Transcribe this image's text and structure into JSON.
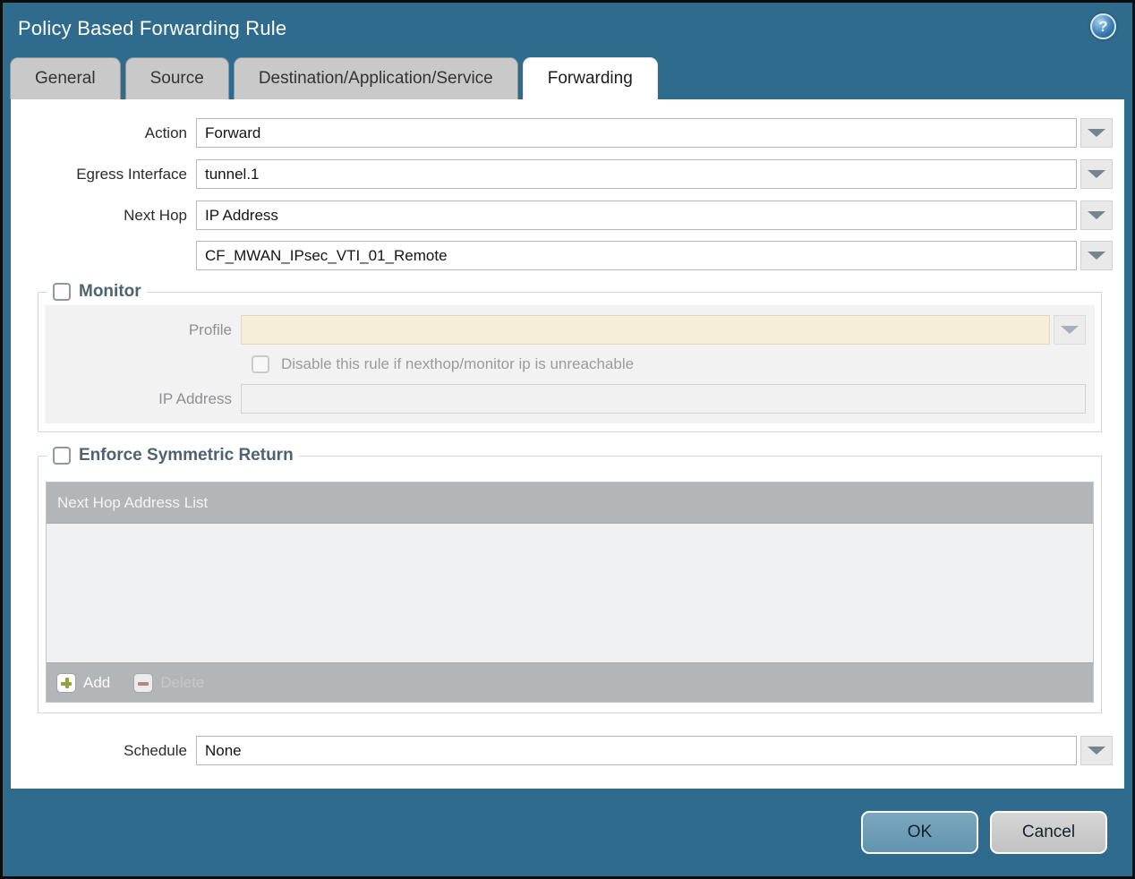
{
  "dialog": {
    "title": "Policy Based Forwarding Rule",
    "help_glyph": "?"
  },
  "tabs": [
    {
      "label": "General",
      "active": false
    },
    {
      "label": "Source",
      "active": false
    },
    {
      "label": "Destination/Application/Service",
      "active": false
    },
    {
      "label": "Forwarding",
      "active": true
    }
  ],
  "form": {
    "action": {
      "label": "Action",
      "value": "Forward"
    },
    "egress_interface": {
      "label": "Egress Interface",
      "value": "tunnel.1"
    },
    "next_hop": {
      "label": "Next Hop",
      "type_value": "IP Address",
      "address_value": "CF_MWAN_IPsec_VTI_01_Remote"
    },
    "schedule": {
      "label": "Schedule",
      "value": "None"
    }
  },
  "monitor": {
    "legend": "Monitor",
    "checked": false,
    "profile": {
      "label": "Profile",
      "value": ""
    },
    "disable_rule": {
      "label": "Disable this rule if nexthop/monitor ip is unreachable",
      "checked": false
    },
    "ip_address": {
      "label": "IP Address",
      "value": ""
    }
  },
  "symmetric_return": {
    "legend": "Enforce Symmetric Return",
    "checked": false,
    "table": {
      "header": "Next Hop Address List",
      "rows": [],
      "add_label": "Add",
      "delete_label": "Delete",
      "delete_enabled": false
    }
  },
  "footer": {
    "ok_label": "OK",
    "cancel_label": "Cancel"
  },
  "colors": {
    "titlebar_teal": "#2f6b8c",
    "tab_inactive": "#c9c9c9",
    "tab_active": "#ffffff",
    "section_legend_text": "#4e6372",
    "disabled_field_cream": "#f5efda",
    "panel_gray": "#f2f2f2",
    "table_bar_gray": "#b2b6b9",
    "table_body_gray": "#eff0f1",
    "add_icon_green": "#97a13b",
    "delete_icon_red": "#b5766b",
    "ok_button_teal": "#6b9db8",
    "cancel_button_gray": "#c9c9c9"
  }
}
